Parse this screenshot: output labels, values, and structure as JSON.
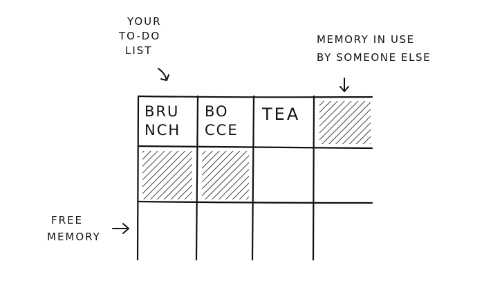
{
  "annotations": {
    "your_todo_list": [
      "YOUR",
      "TO-DO",
      "LIST"
    ],
    "memory_in_use": [
      "MEMORY IN USE",
      "BY SOMEONE ELSE"
    ],
    "free_memory": [
      "FREE",
      "MEMORY"
    ]
  },
  "cells": {
    "brunch": [
      "BRU",
      "NCH"
    ],
    "bocce": [
      "BO",
      "CCE"
    ],
    "tea": "TEA"
  },
  "colors": {
    "ink": "#111111",
    "background": "#ffffff"
  }
}
